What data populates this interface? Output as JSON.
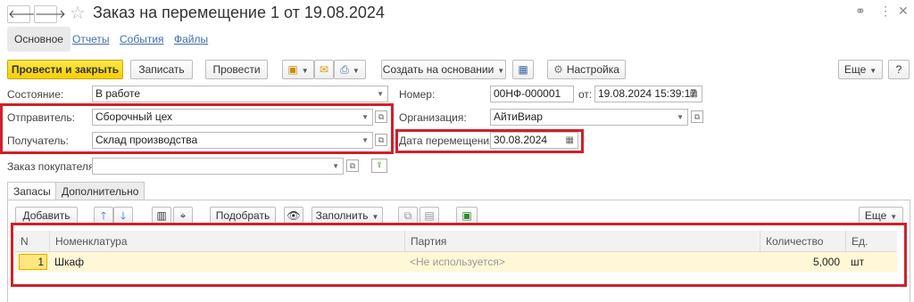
{
  "window": {
    "title": "Заказ на перемещение 1 от 19.08.2024",
    "more_icon": "⋮",
    "close_icon": "✕",
    "link_icon": "🔗"
  },
  "sections": {
    "main": "Основное",
    "reports": "Отчеты",
    "events": "События",
    "files": "Файлы"
  },
  "toolbar": {
    "post_close": "Провести и закрыть",
    "save": "Записать",
    "post": "Провести",
    "create_based": "Создать на основании",
    "settings": "Настройка",
    "more": "Еще",
    "help": "?"
  },
  "form": {
    "state_label": "Состояние:",
    "state_value": "В работе",
    "sender_label": "Отправитель:",
    "sender_value": "Сборочный цех",
    "receiver_label": "Получатель:",
    "receiver_value": "Склад производства",
    "customer_order_label": "Заказ покупателя:",
    "customer_order_value": "",
    "number_label": "Номер:",
    "number_value": "00НФ-000001",
    "from_label": "от:",
    "from_value": "19.08.2024 15:39:17",
    "org_label": "Организация:",
    "org_value": "АйтиВиар",
    "move_date_label": "Дата перемещения:",
    "move_date_value": "30.08.2024"
  },
  "tabs": {
    "stock": "Запасы",
    "extra": "Дополнительно"
  },
  "table_toolbar": {
    "add": "Добавить",
    "pick": "Подобрать",
    "fill": "Заполнить",
    "more": "Еще"
  },
  "table": {
    "headers": {
      "n": "N",
      "nomenclature": "Номенклатура",
      "batch": "Партия",
      "qty": "Количество",
      "unit": "Ед."
    },
    "rows": [
      {
        "n": "1",
        "nomenclature": "Шкаф",
        "batch": "<Не используется>",
        "qty": "5,000",
        "unit": "шт"
      }
    ]
  }
}
